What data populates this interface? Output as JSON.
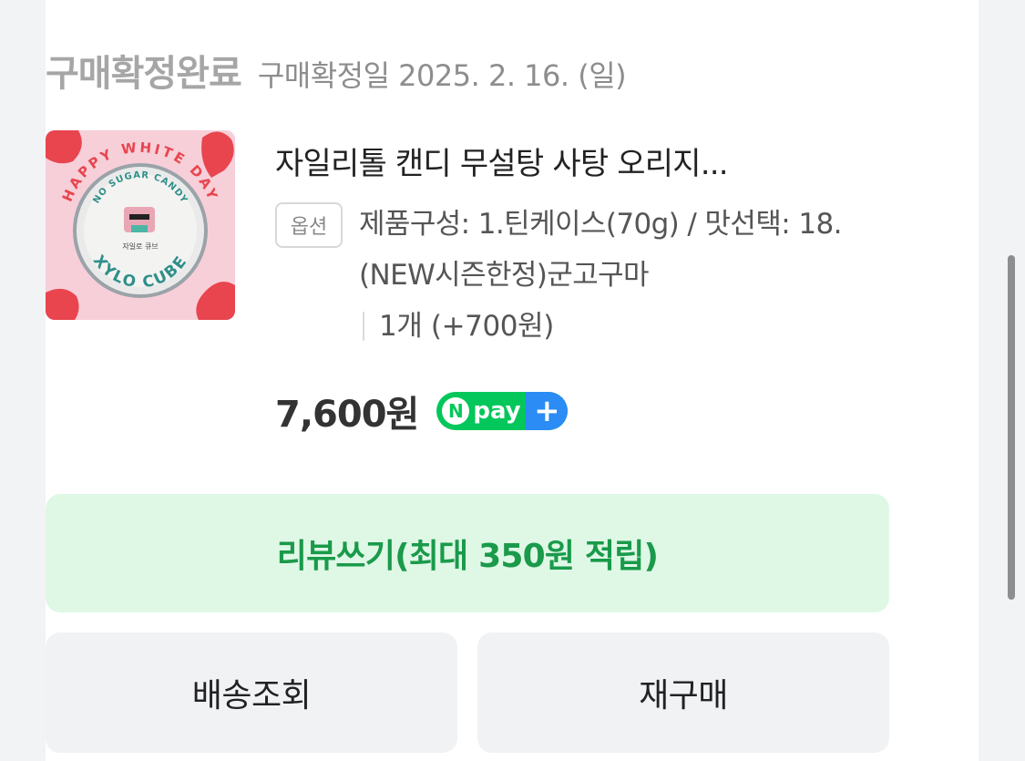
{
  "order": {
    "status_title": "구매확정완료",
    "status_date": "구매확정일 2025. 2. 16. (일)"
  },
  "product": {
    "image_texts": {
      "arc_top": "HAPPY WHITE DAY",
      "arc_inner": "NO SUGAR CANDY",
      "brand": "XYLO CUBE",
      "label": "자일로 큐브"
    },
    "name": "자일리톨 캔디 무설탕 사탕 오리지...",
    "option_badge": "옵션",
    "option_text": "제품구성: 1.틴케이스(70g) / 맛선택: 18.(NEW시즌한정)군고구마",
    "quantity_text": "1개 (+700원)",
    "price": "7,600원"
  },
  "npay": {
    "n": "N",
    "text": "pay",
    "plus": "+"
  },
  "buttons": {
    "review": "리뷰쓰기(최대 350원 적립)",
    "track": "배송조회",
    "rebuy": "재구매"
  },
  "colors": {
    "accent_green": "#03c75a",
    "review_bg": "#dff8e6",
    "review_text": "#1a9a4a",
    "npay_blue": "#2a8cf4"
  }
}
